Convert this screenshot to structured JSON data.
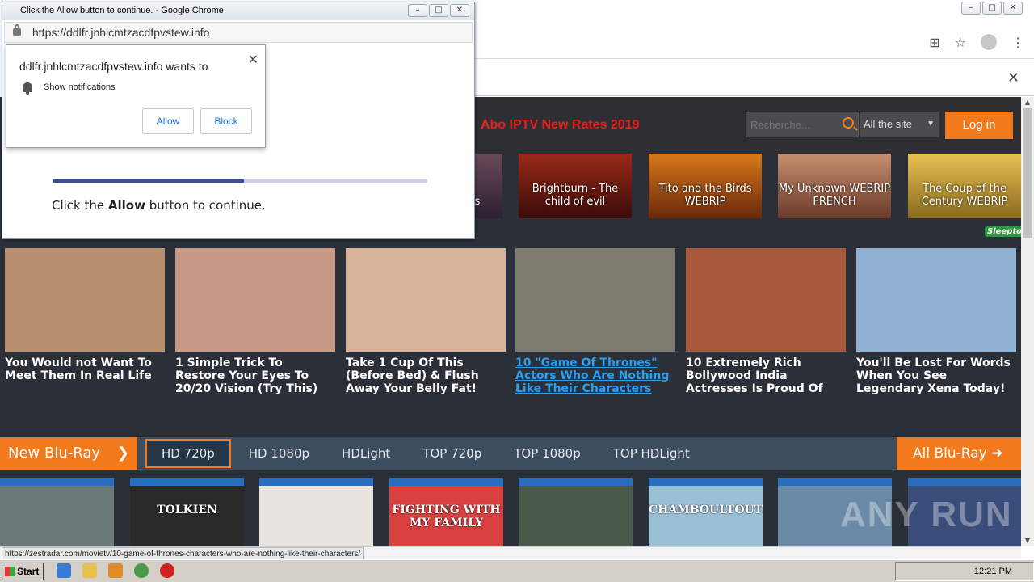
{
  "popup": {
    "window_title": "Click the Allow button to continue. - Google Chrome",
    "url": "https://ddlfr.jnhlcmtzacdfpvstew.info",
    "notification": {
      "site_text": "ddlfr.jnhlcmtzacdfpvstew.info wants to",
      "permission": "Show notifications",
      "allow_label": "Allow",
      "block_label": "Block"
    },
    "progress_fraction": 0.51,
    "message_pre": "Click the ",
    "message_bold": "Allow",
    "message_post": " button to continue."
  },
  "site": {
    "promo": "Abo IPTV New Rates 2019",
    "search_placeholder": "Recherche...",
    "scope_selected": "All the site",
    "login_label": "Log in",
    "movies": [
      {
        "label": "s"
      },
      {
        "label": "Brightburn - The child of evil"
      },
      {
        "label": "Tito and the Birds WEBRIP"
      },
      {
        "label": "My Unknown WEBRIP FRENCH"
      },
      {
        "label": "The Coup of the Century WEBRIP"
      }
    ],
    "sponsor": "Sleepto",
    "ads": [
      {
        "title": "You Would not Want To Meet Them In Real Life",
        "color": "#b89070"
      },
      {
        "title": "1 Simple Trick To Restore Your Eyes To 20/20 Vision (Try This)",
        "color": "#c69a86"
      },
      {
        "title": "Take 1 Cup Of This (Before Bed) & Flush Away Your Belly Fat!",
        "color": "#d6b49c"
      },
      {
        "title": "10 \"Game Of Thrones\" Actors Who Are Nothing Like Their Characters",
        "color": "#7f7a70",
        "link": true
      },
      {
        "title": "10 Extremely Rich Bollywood India Actresses Is Proud Of",
        "color": "#a8583c"
      },
      {
        "title": "You'll Be Lost For Words When You See Legendary Xena Today!",
        "color": "#8fb2d2"
      }
    ],
    "bluray": {
      "label": "New Blu-Ray",
      "tabs": [
        "HD 720p",
        "HD 1080p",
        "HDLight",
        "TOP 720p",
        "TOP 1080p",
        "TOP HDLight"
      ],
      "active_tab": "HD 720p",
      "all_label": "All Blu-Ray"
    },
    "covers": [
      {
        "text": "",
        "color": "#6a7a7a"
      },
      {
        "text": "TOLKIEN",
        "color": "#2a2a2a"
      },
      {
        "text": "",
        "color": "#e8e4e0"
      },
      {
        "text": "FIGHTING WITH MY FAMILY",
        "color": "#d94040"
      },
      {
        "text": "",
        "color": "#4a5a4a"
      },
      {
        "text": "CHAMBOULTOUT",
        "color": "#9ac0d8"
      },
      {
        "text": "",
        "color": "#6a8aa8"
      },
      {
        "text": "",
        "color": "#3a4c7a"
      }
    ]
  },
  "status_url": "https://zestradar.com/movietv/10-game-of-thrones-characters-who-are-nothing-like-their-characters/",
  "watermark": "ANY RUN",
  "taskbar": {
    "start_label": "Start",
    "clock": "12:21 PM"
  }
}
